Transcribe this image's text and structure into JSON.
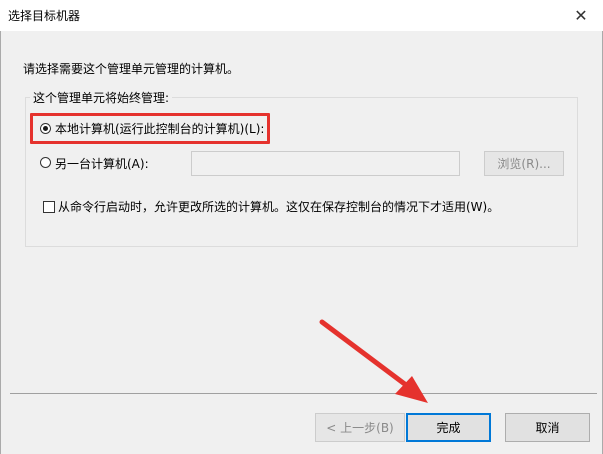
{
  "window": {
    "title": "选择目标机器",
    "close_icon": "close-icon"
  },
  "instruction": "请选择需要这个管理单元管理的计算机。",
  "group": {
    "legend": "这个管理单元将始终管理:",
    "local_option": {
      "label": "本地计算机(运行此控制台的计算机)(L):",
      "selected": true
    },
    "remote_option": {
      "label": "另一台计算机(A):",
      "selected": false
    },
    "remote_computer_value": "",
    "browse_label": "浏览(R)...",
    "allow_change_checkbox": {
      "label": "从命令行启动时，允许更改所选的计算机。这仅在保存控制台的情况下才适用(W)。",
      "checked": false
    }
  },
  "buttons": {
    "back_label": "< 上一步(B)",
    "finish_label": "完成",
    "cancel_label": "取消"
  },
  "annotations": {
    "highlight_color": "#e5322d",
    "arrow_color": "#e5322d"
  },
  "colors": {
    "window_bg": "#f0f0f0",
    "accent": "#0078d7"
  }
}
